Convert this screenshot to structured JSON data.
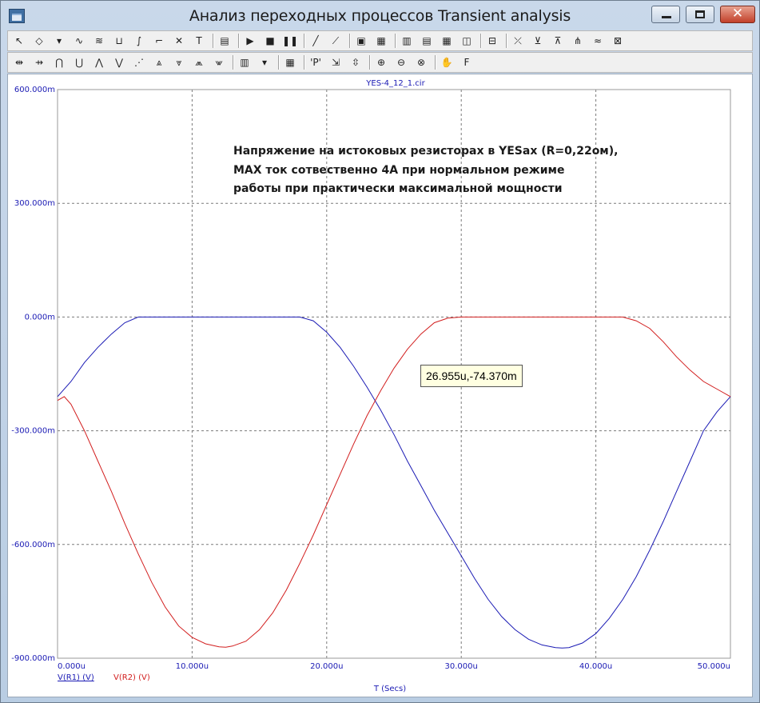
{
  "window": {
    "title": "Анализ переходных процессов Transient analysis",
    "minimize_glyph": "",
    "maximize_glyph": "",
    "close_glyph": "✕"
  },
  "toolbar1": [
    {
      "name": "select-arrow-icon",
      "glyph": "↖"
    },
    {
      "name": "node-select-icon",
      "glyph": "◇"
    },
    {
      "name": "dropdown-arrow-icon",
      "glyph": "▾"
    },
    {
      "name": "scale-wave-icon",
      "glyph": "∿"
    },
    {
      "name": "stack-wave-icon",
      "glyph": "≋"
    },
    {
      "name": "bracket-wave-icon",
      "glyph": "⊔"
    },
    {
      "name": "derivative-icon",
      "glyph": "∫"
    },
    {
      "name": "step-icon",
      "glyph": "⌐"
    },
    {
      "name": "xy-plot-icon",
      "glyph": "✕"
    },
    {
      "name": "text-tool-icon",
      "glyph": "T"
    },
    {
      "name": "properties-icon",
      "glyph": "▤"
    },
    {
      "name": "run-icon",
      "glyph": "▶"
    },
    {
      "name": "stop-icon",
      "glyph": "■"
    },
    {
      "name": "pause-icon",
      "glyph": "❚❚"
    },
    {
      "name": "line-tool-icon",
      "glyph": "╱"
    },
    {
      "name": "tangent-line-icon",
      "glyph": "⟋"
    },
    {
      "name": "frame-icon",
      "glyph": "▣"
    },
    {
      "name": "grid-icon",
      "glyph": "▦"
    },
    {
      "name": "vertical-grid-icon",
      "glyph": "▥"
    },
    {
      "name": "horizontal-grid-icon",
      "glyph": "▤"
    },
    {
      "name": "minor-grid-icon",
      "glyph": "▦"
    },
    {
      "name": "axis-grid-icon",
      "glyph": "◫"
    },
    {
      "name": "baseline-icon",
      "glyph": "⊟"
    },
    {
      "name": "point-marker-icon",
      "glyph": "⤫"
    },
    {
      "name": "peak-icon",
      "glyph": "⊻"
    },
    {
      "name": "valley-icon",
      "glyph": "⊼"
    },
    {
      "name": "inflection-icon",
      "glyph": "⋔"
    },
    {
      "name": "slope-icon",
      "glyph": "≈"
    },
    {
      "name": "close-plot-icon",
      "glyph": "⊠"
    }
  ],
  "toolbar2": [
    {
      "name": "cursor-left-icon",
      "glyph": "⇹"
    },
    {
      "name": "cursor-right-icon",
      "glyph": "⇸"
    },
    {
      "name": "peak-next-icon",
      "glyph": "⋂"
    },
    {
      "name": "valley-next-icon",
      "glyph": "⋃"
    },
    {
      "name": "high-icon",
      "glyph": "⋀"
    },
    {
      "name": "low-icon",
      "glyph": "⋁"
    },
    {
      "name": "rise-icon",
      "glyph": "⋰"
    },
    {
      "name": "global-high-icon",
      "glyph": "⩓"
    },
    {
      "name": "global-low-icon",
      "glyph": "⩔"
    },
    {
      "name": "global-peak-icon",
      "glyph": "⩕"
    },
    {
      "name": "global-valley-icon",
      "glyph": "⩖"
    },
    {
      "name": "color-palette-icon",
      "glyph": "▥"
    },
    {
      "name": "dropdown-arrow-icon",
      "glyph": "▾"
    },
    {
      "name": "data-table-icon",
      "glyph": "▦"
    },
    {
      "name": "point-tag-icon",
      "glyph": "'P'"
    },
    {
      "name": "horizontal-tag-icon",
      "glyph": "⇲"
    },
    {
      "name": "vertical-tag-icon",
      "glyph": "⇳"
    },
    {
      "name": "zoom-in-icon",
      "glyph": "⊕"
    },
    {
      "name": "zoom-out-icon",
      "glyph": "⊖"
    },
    {
      "name": "zoom-fit-icon",
      "glyph": "⊗"
    },
    {
      "name": "pan-icon",
      "glyph": "✋"
    },
    {
      "name": "font-icon",
      "glyph": "F"
    }
  ],
  "plot": {
    "file_name": "YES-4_12_1.cir",
    "annotation_lines": [
      "Напряжение на истоковых резисторах в YESax (R=0,22ом),",
      "MAX ток  сотвественно 4А при нормальном режиме",
      "работы при практически максимальной мощности"
    ],
    "tooltip": "26.955u,-74.370m",
    "xlabel": "T (Secs)",
    "legend": [
      {
        "label": "V(R1) (V)",
        "color": "#1a1ab4"
      },
      {
        "label": "V(R2) (V)",
        "color": "#d21e1e"
      }
    ],
    "colors": {
      "axis_text": "#1a1ab4",
      "grid": "#7a7a7a",
      "r1": "#1a1ab4",
      "r2": "#d21e1e"
    }
  },
  "chart_data": {
    "type": "line",
    "title": "YES-4_12_1.cir",
    "xlabel": "T (Secs)",
    "ylabel": "",
    "xlim": [
      0,
      50
    ],
    "ylim": [
      -900,
      600
    ],
    "x_unit": "u",
    "y_unit": "m",
    "x_ticks": [
      "0.000u",
      "10.000u",
      "20.000u",
      "30.000u",
      "40.000u",
      "50.000u"
    ],
    "y_ticks": [
      "600.000m",
      "300.000m",
      "0.000m",
      "-300.000m",
      "-600.000m",
      "-900.000m"
    ],
    "grid": true,
    "series": [
      {
        "name": "V(R1) (V)",
        "color": "#1a1ab4",
        "x": [
          0,
          1,
          2,
          3,
          4,
          5,
          6,
          8,
          10,
          12,
          14,
          16,
          18,
          19,
          20,
          21,
          22,
          23,
          24,
          25,
          26,
          27,
          28,
          29,
          30,
          31,
          32,
          33,
          34,
          35,
          36,
          37,
          37.5,
          38,
          39,
          40,
          41,
          42,
          43,
          44,
          45,
          46,
          47,
          48,
          49,
          50
        ],
        "y": [
          -210,
          -170,
          -120,
          -80,
          -45,
          -15,
          0,
          0,
          0,
          0,
          0,
          0,
          0,
          -10,
          -40,
          -80,
          -130,
          -185,
          -245,
          -310,
          -380,
          -445,
          -510,
          -570,
          -630,
          -690,
          -745,
          -790,
          -825,
          -850,
          -865,
          -872,
          -873,
          -872,
          -860,
          -835,
          -795,
          -745,
          -685,
          -615,
          -540,
          -460,
          -380,
          -300,
          -250,
          -210
        ]
      },
      {
        "name": "V(R2) (V)",
        "color": "#d21e1e",
        "x": [
          0,
          0.5,
          1,
          2,
          3,
          4,
          5,
          6,
          7,
          8,
          9,
          10,
          11,
          12,
          12.5,
          13,
          14,
          15,
          16,
          17,
          18,
          19,
          20,
          21,
          22,
          23,
          24,
          25,
          26,
          27,
          28,
          29,
          30,
          31,
          32,
          34,
          36,
          38,
          40,
          42,
          43,
          44,
          45,
          46,
          47,
          48,
          49,
          50
        ],
        "y": [
          -220,
          -210,
          -230,
          -300,
          -380,
          -460,
          -545,
          -625,
          -700,
          -765,
          -815,
          -845,
          -862,
          -870,
          -871,
          -868,
          -855,
          -825,
          -780,
          -720,
          -650,
          -575,
          -495,
          -415,
          -335,
          -260,
          -195,
          -135,
          -85,
          -45,
          -15,
          -3,
          0,
          0,
          0,
          0,
          0,
          0,
          0,
          0,
          -10,
          -30,
          -65,
          -105,
          -140,
          -170,
          -190,
          -210
        ]
      }
    ]
  }
}
